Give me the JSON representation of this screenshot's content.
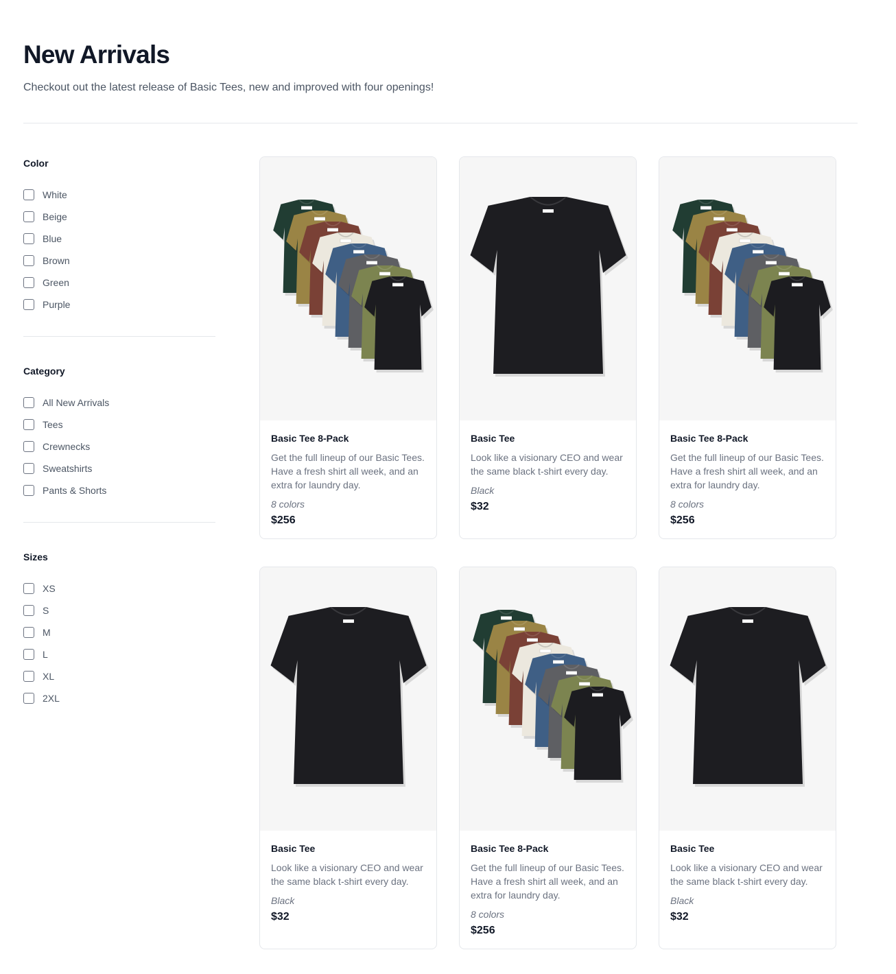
{
  "header": {
    "title": "New Arrivals",
    "subtitle": "Checkout out the latest release of Basic Tees, new and improved with four openings!"
  },
  "filters": [
    {
      "title": "Color",
      "options": [
        "White",
        "Beige",
        "Blue",
        "Brown",
        "Green",
        "Purple"
      ]
    },
    {
      "title": "Category",
      "options": [
        "All New Arrivals",
        "Tees",
        "Crewnecks",
        "Sweatshirts",
        "Pants & Shorts"
      ]
    },
    {
      "title": "Sizes",
      "options": [
        "XS",
        "S",
        "M",
        "L",
        "XL",
        "2XL"
      ]
    }
  ],
  "products": [
    {
      "name": "Basic Tee 8-Pack",
      "description": "Get the full lineup of our Basic Tees. Have a fresh shirt all week, and an extra for laundry day.",
      "options": "8 colors",
      "price": "$256",
      "image": "tee-8-pack"
    },
    {
      "name": "Basic Tee",
      "description": "Look like a visionary CEO and wear the same black t-shirt every day.",
      "options": "Black",
      "price": "$32",
      "image": "tee-black"
    },
    {
      "name": "Basic Tee 8-Pack",
      "description": "Get the full lineup of our Basic Tees. Have a fresh shirt all week, and an extra for laundry day.",
      "options": "8 colors",
      "price": "$256",
      "image": "tee-8-pack"
    },
    {
      "name": "Basic Tee",
      "description": "Look like a visionary CEO and wear the same black t-shirt every day.",
      "options": "Black",
      "price": "$32",
      "image": "tee-black"
    },
    {
      "name": "Basic Tee 8-Pack",
      "description": "Get the full lineup of our Basic Tees. Have a fresh shirt all week, and an extra for laundry day.",
      "options": "8 colors",
      "price": "$256",
      "image": "tee-8-pack"
    },
    {
      "name": "Basic Tee",
      "description": "Look like a visionary CEO and wear the same black t-shirt every day.",
      "options": "Black",
      "price": "$32",
      "image": "tee-black"
    }
  ],
  "colors": {
    "text_primary": "#111827",
    "text_secondary": "#4b5563",
    "border": "#e5e7eb",
    "image_bg": "#f6f6f6",
    "tee_pack": [
      "#213d33",
      "#9a8445",
      "#7a4136",
      "#ece8de",
      "#3f5f85",
      "#5e5f63",
      "#7c8450",
      "#1c1c20"
    ],
    "tee_black": "#1d1d21"
  }
}
